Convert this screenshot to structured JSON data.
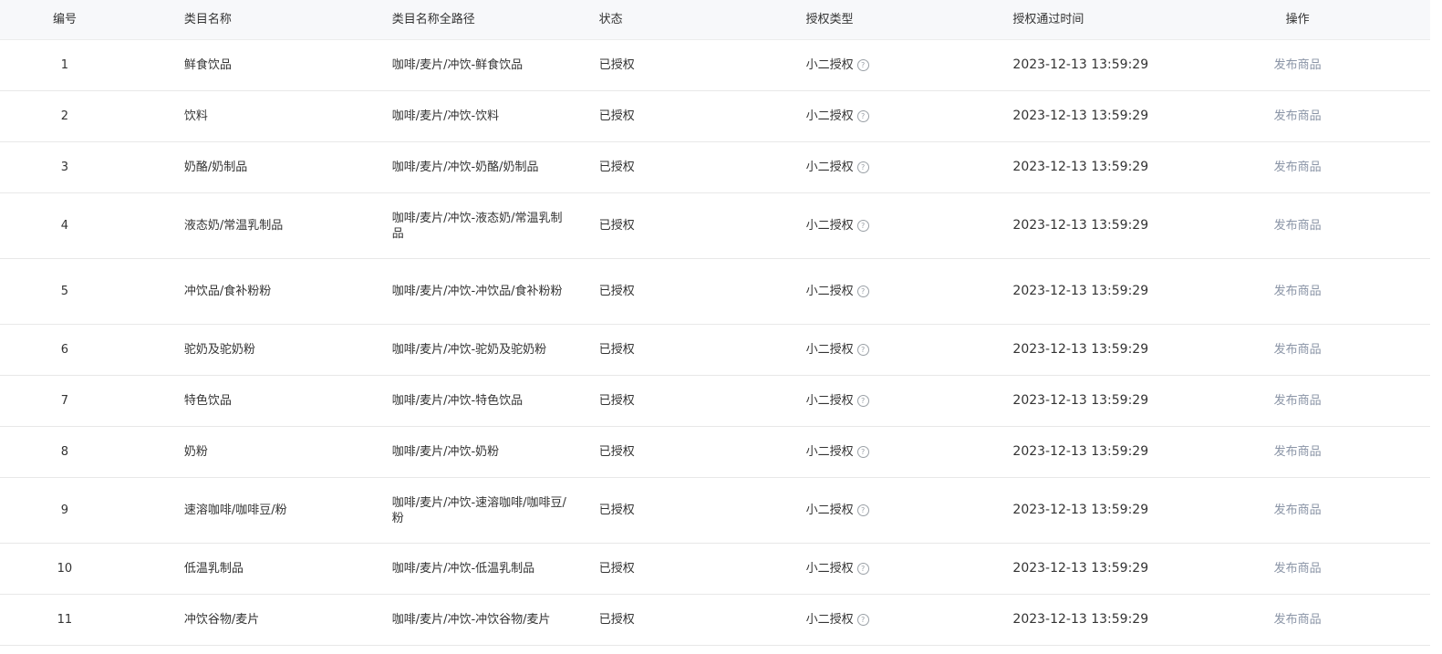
{
  "table": {
    "headers": {
      "no": "编号",
      "name": "类目名称",
      "path": "类目名称全路径",
      "status": "状态",
      "auth_type": "授权类型",
      "auth_time": "授权通过时间",
      "action": "操作"
    },
    "rows": [
      {
        "no": "1",
        "name": "鲜食饮品",
        "path": "咖啡/麦片/冲饮-鲜食饮品",
        "status": "已授权",
        "auth_type": "小二授权",
        "auth_time": "2023-12-13 13:59:29",
        "action": "发布商品"
      },
      {
        "no": "2",
        "name": "饮料",
        "path": "咖啡/麦片/冲饮-饮料",
        "status": "已授权",
        "auth_type": "小二授权",
        "auth_time": "2023-12-13 13:59:29",
        "action": "发布商品"
      },
      {
        "no": "3",
        "name": "奶酪/奶制品",
        "path": "咖啡/麦片/冲饮-奶酪/奶制品",
        "status": "已授权",
        "auth_type": "小二授权",
        "auth_time": "2023-12-13 13:59:29",
        "action": "发布商品"
      },
      {
        "no": "4",
        "name": "液态奶/常温乳制品",
        "path": "咖啡/麦片/冲饮-液态奶/常温乳制品",
        "status": "已授权",
        "auth_type": "小二授权",
        "auth_time": "2023-12-13 13:59:29",
        "action": "发布商品"
      },
      {
        "no": "5",
        "name": "冲饮品/食补粉粉",
        "path": "咖啡/麦片/冲饮-冲饮品/食补粉粉",
        "status": "已授权",
        "auth_type": "小二授权",
        "auth_time": "2023-12-13 13:59:29",
        "action": "发布商品"
      },
      {
        "no": "6",
        "name": "驼奶及驼奶粉",
        "path": "咖啡/麦片/冲饮-驼奶及驼奶粉",
        "status": "已授权",
        "auth_type": "小二授权",
        "auth_time": "2023-12-13 13:59:29",
        "action": "发布商品"
      },
      {
        "no": "7",
        "name": "特色饮品",
        "path": "咖啡/麦片/冲饮-特色饮品",
        "status": "已授权",
        "auth_type": "小二授权",
        "auth_time": "2023-12-13 13:59:29",
        "action": "发布商品"
      },
      {
        "no": "8",
        "name": "奶粉",
        "path": "咖啡/麦片/冲饮-奶粉",
        "status": "已授权",
        "auth_type": "小二授权",
        "auth_time": "2023-12-13 13:59:29",
        "action": "发布商品"
      },
      {
        "no": "9",
        "name": "速溶咖啡/咖啡豆/粉",
        "path": "咖啡/麦片/冲饮-速溶咖啡/咖啡豆/粉",
        "status": "已授权",
        "auth_type": "小二授权",
        "auth_time": "2023-12-13 13:59:29",
        "action": "发布商品"
      },
      {
        "no": "10",
        "name": "低温乳制品",
        "path": "咖啡/麦片/冲饮-低温乳制品",
        "status": "已授权",
        "auth_type": "小二授权",
        "auth_time": "2023-12-13 13:59:29",
        "action": "发布商品"
      },
      {
        "no": "11",
        "name": "冲饮谷物/麦片",
        "path": "咖啡/麦片/冲饮-冲饮谷物/麦片",
        "status": "已授权",
        "auth_type": "小二授权",
        "auth_time": "2023-12-13 13:59:29",
        "action": "发布商品"
      }
    ]
  }
}
